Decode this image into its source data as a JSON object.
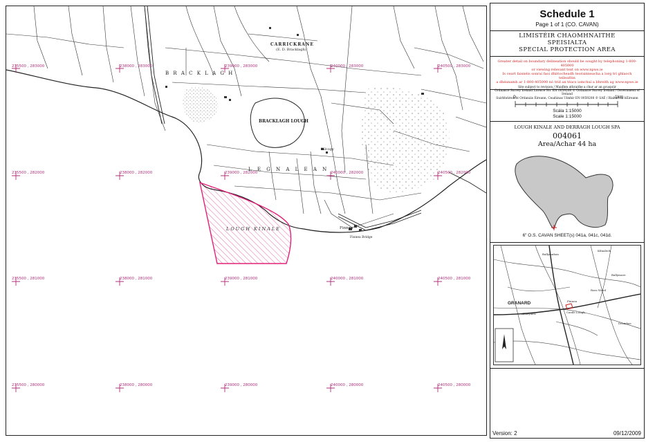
{
  "schedule": {
    "title": "Schedule 1",
    "page": "Page 1 of 1 (CO. CAVAN)"
  },
  "designation": {
    "line1": "LIMISTÉIR CHAOMHNAITHE",
    "line2": "SPEISIALTA",
    "line3": "SPECIAL PROTECTION AREA"
  },
  "notes": {
    "red1": "Greater detail on boundary delineation should be sought by telephoning 1-800-405000",
    "red2": "or viewing relevant text on www.npws.ie",
    "red3": "Is ceart faisnéis sonraí faoi dhíriocheadh teorainneacha a lorg trí ghlaoch teileafóin",
    "red4": "a dhéanamh ar 1-800-405000 nó tríd an téacs iomchuí a bhreith ag www.npws.ie",
    "tiny1": "Site subject to revision / Maidhm athraithe a chur ar an gcuspóir",
    "tiny2": "Ordnance Survey Ireland Licence No. EN 0059208 © Ordnance Survey Ireland / Government of Ireland",
    "tiny3": "Suirbhéireacht Ordanáis Éireann, Ceadúnas Uimhir EN 0059208 © SAÉ / Rialtas na hÉireann"
  },
  "scale": {
    "start": "0",
    "end": "1km",
    "irish": "Scála 1:15000",
    "english": "Scale 1:15000"
  },
  "site": {
    "name": "LOUGH KINALE AND DERRAGH LOUGH SPA",
    "code": "004061",
    "area": "Area/Achar 44 ha",
    "sheets": "6\" O.S.  CAVAN   SHEET(s) 041a, 041c, 041d."
  },
  "footer": {
    "version": "Version: 2",
    "date": "09/12/2009"
  },
  "map": {
    "grid_labels": [
      "235500 , 283000",
      "238000 , 283000",
      "239000 , 283000",
      "240000 , 283000",
      "240500 , 283000",
      "235500 , 282000",
      "238000 , 282000",
      "239000 , 282000",
      "240000 , 282000",
      "240500 , 282000",
      "235500 , 281000",
      "238000 , 281000",
      "239000 , 281000",
      "240000 , 281000",
      "240500 , 281000",
      "235500 , 280000",
      "238000 , 280000",
      "239000 , 280000",
      "240000 , 280000",
      "240500 , 280000"
    ],
    "features": {
      "carrickrane": "CARRICKRANE",
      "ed": "(E. D. Bracklagh)",
      "bracklagh": "B R A C K L A G H",
      "bracklagh_lough": "BRACKLAGH LOUGH",
      "kildallon": "L E G N A L E A N",
      "lough_kinale": "LOUGH KINALE",
      "finnea": "Finnea",
      "finnea_bridge": "Finnea Bridge",
      "kilcogy": "Kilcogy"
    }
  },
  "locator": {
    "granard": "GRANARD",
    "places": [
      "Ballymahon",
      "Kilnaleck",
      "Finnea",
      "Ross Wood",
      "Castle Lough",
      "Abbeylara",
      "Ballymore",
      "Drumbee"
    ]
  },
  "colors": {
    "spa_boundary": "#e0207a",
    "grid_marker": "#b0307a",
    "note_red": "#d21f1f"
  }
}
